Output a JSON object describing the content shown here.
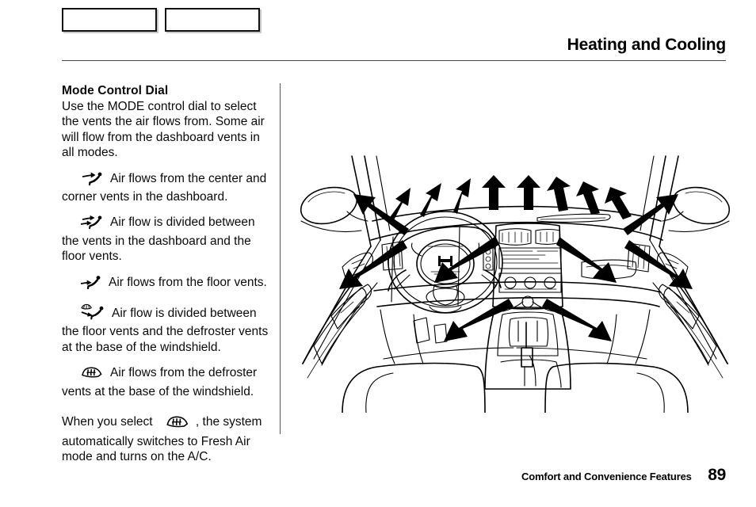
{
  "header": {
    "title": "Heating and Cooling"
  },
  "top_boxes": [
    {
      "name": "blank-box-left",
      "label": ""
    },
    {
      "name": "blank-box-right",
      "label": ""
    }
  ],
  "body": {
    "section_title": "Mode Control Dial",
    "intro": "Use the MODE control dial to select the vents the air flows from. Some air will flow from the dashboard vents in all modes.",
    "modes": [
      {
        "icon": "vent-face-icon",
        "text": "Air flows from the center and corner vents in the dashboard."
      },
      {
        "icon": "vent-face-floor-icon",
        "text": "Air flow is divided between the vents in the dashboard and the floor vents."
      },
      {
        "icon": "vent-floor-icon",
        "text": "Air flows from the floor vents."
      },
      {
        "icon": "vent-floor-defrost-icon",
        "text": "Air flow is divided between the floor vents and the defroster vents at the base of the windshield."
      },
      {
        "icon": "vent-defrost-icon",
        "text": "Air flows from the defroster vents at the base of the windshield."
      }
    ],
    "final_note": {
      "before_icon": "When you select",
      "icon": "vent-defrost-icon",
      "after_icon": ", the system automatically switches to Fresh Air mode and turns on the A/C."
    }
  },
  "figure": {
    "name": "dashboard-airflow-illustration",
    "description": "Line drawing of car interior dashboard viewed from rear seat, with black arrows showing airflow from defroster, dashboard, corner and floor vents",
    "arrow_color": "#000000",
    "line_color": "#000000",
    "arrow_groups": [
      {
        "name": "defroster-arrows",
        "count": 8,
        "direction": "up"
      },
      {
        "name": "corner-vent-arrows",
        "count": 4,
        "direction": "diagonal-outward"
      },
      {
        "name": "center-vent-arrows",
        "count": 2,
        "direction": "diagonal-outward"
      },
      {
        "name": "floor-vent-arrows",
        "count": 2,
        "direction": "diagonal-down-outward"
      }
    ]
  },
  "footer": {
    "label": "Comfort and Convenience Features",
    "page_number": "89"
  }
}
